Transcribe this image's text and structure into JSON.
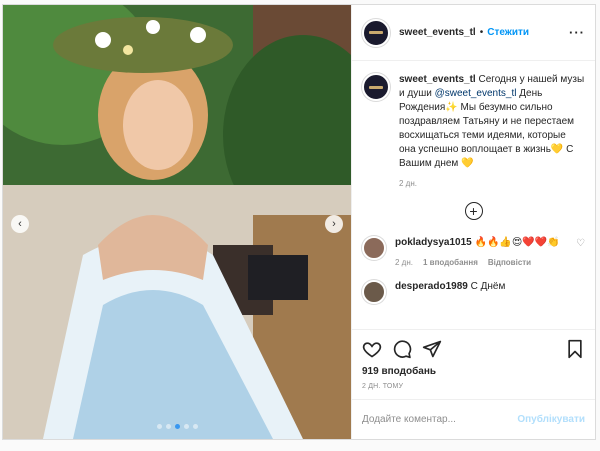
{
  "post": {
    "nav_prev": "‹",
    "nav_next": "›",
    "carousel_count": 5,
    "carousel_active": 3
  },
  "header": {
    "username": "sweet_events_tl",
    "separator": "•",
    "follow_label": "Стежити",
    "more_label": "···"
  },
  "caption": {
    "username": "sweet_events_tl",
    "text_1": " Сегодня у нашей музы и души ",
    "mention": "@sweet_events_tl",
    "text_2": " День Рождения✨ Мы безумно сильно поздравляем Татьяну и не перестаем восхищаться теми идеями, которые она успешно воплощает в жизнь💛 С Вашим днем 💛",
    "time": "2 дн."
  },
  "load_more_label": "+",
  "comments": [
    {
      "username": "pokladysya1015",
      "text": " 🔥🔥👍😍❤️❤️👏",
      "time": "2 дн.",
      "likes": "1 вподобання",
      "reply": "Відповісти"
    },
    {
      "username": "desperado1989",
      "text": " С Днём"
    }
  ],
  "actions": {
    "likes_count": "919 вподобань",
    "date": "2 ДН. ТОМУ"
  },
  "add_comment": {
    "placeholder": "Додайте коментар...",
    "publish_label": "Опублікувати"
  },
  "colors": {
    "accent": "#0095f6",
    "publish_disabled": "#b2dffc",
    "border": "#dbdbdb"
  }
}
